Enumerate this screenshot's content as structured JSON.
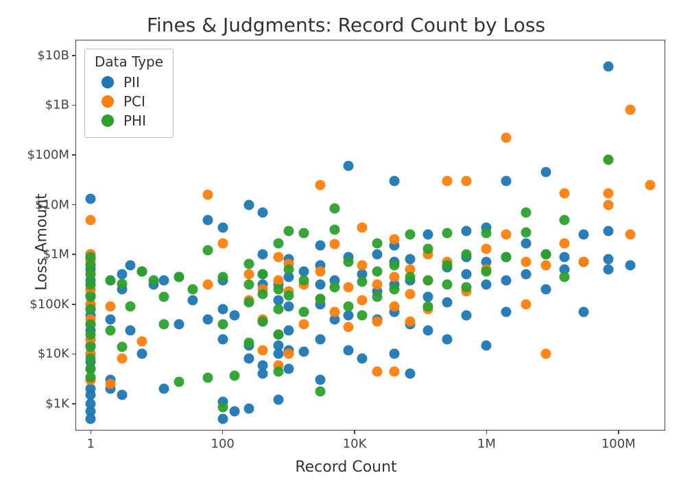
{
  "chart_data": {
    "type": "scatter",
    "title": "Fines & Judgments: Record Count by Loss",
    "xlabel": "Record Count",
    "ylabel": "Loss Amount",
    "xscale": "log",
    "yscale": "log",
    "xlim": [
      0.6,
      500000000
    ],
    "ylim": [
      300,
      20000000000
    ],
    "xticks": [
      1,
      100,
      10000,
      1000000,
      100000000
    ],
    "xticklabels": [
      "1",
      "100",
      "10K",
      "1M",
      "100M"
    ],
    "yticks": [
      1000,
      10000,
      100000,
      1000000,
      10000000,
      100000000,
      1000000000,
      10000000000
    ],
    "yticklabels": [
      "$1K",
      "$10K",
      "$100K",
      "$1M",
      "$10M",
      "$100M",
      "$1B",
      "$10B"
    ],
    "legend": {
      "title": "Data Type",
      "entries": [
        "PII",
        "PCI",
        "PHI"
      ],
      "position": "upper-left"
    },
    "colors": {
      "PII": "#1f77b4",
      "PCI": "#ff7f0e",
      "PHI": "#2ca02c"
    },
    "series": [
      {
        "name": "PII",
        "points": [
          [
            1,
            13000000
          ],
          [
            1,
            1000000
          ],
          [
            1,
            800000
          ],
          [
            1,
            600000
          ],
          [
            1,
            500000
          ],
          [
            1,
            400000
          ],
          [
            1,
            300000
          ],
          [
            1,
            250000
          ],
          [
            1,
            200000
          ],
          [
            1,
            150000
          ],
          [
            1,
            100000
          ],
          [
            1,
            80000
          ],
          [
            1,
            60000
          ],
          [
            1,
            40000
          ],
          [
            1,
            30000
          ],
          [
            1,
            20000
          ],
          [
            1,
            15000
          ],
          [
            1,
            10000
          ],
          [
            1,
            7000
          ],
          [
            1,
            5000
          ],
          [
            1,
            3000
          ],
          [
            1,
            2000
          ],
          [
            1,
            1500
          ],
          [
            1,
            1000
          ],
          [
            1,
            700
          ],
          [
            1,
            500
          ],
          [
            2,
            300000
          ],
          [
            2,
            50000
          ],
          [
            2,
            3000
          ],
          [
            2,
            2000
          ],
          [
            3,
            400000
          ],
          [
            3,
            200000
          ],
          [
            3,
            1500
          ],
          [
            4,
            600000
          ],
          [
            4,
            30000
          ],
          [
            6,
            450000
          ],
          [
            6,
            10000
          ],
          [
            9,
            250000
          ],
          [
            13,
            300000
          ],
          [
            13,
            2000
          ],
          [
            22,
            350000
          ],
          [
            22,
            40000
          ],
          [
            35,
            120000
          ],
          [
            60,
            5000000
          ],
          [
            60,
            50000
          ],
          [
            100,
            3500000
          ],
          [
            100,
            300000
          ],
          [
            100,
            80000
          ],
          [
            100,
            20000
          ],
          [
            100,
            1100
          ],
          [
            100,
            500
          ],
          [
            150,
            700
          ],
          [
            150,
            60000
          ],
          [
            250,
            10000000
          ],
          [
            250,
            800
          ],
          [
            250,
            8000
          ],
          [
            250,
            15000
          ],
          [
            400,
            7000000
          ],
          [
            400,
            1000000
          ],
          [
            400,
            400000
          ],
          [
            400,
            250000
          ],
          [
            400,
            45000
          ],
          [
            400,
            6000
          ],
          [
            400,
            4000
          ],
          [
            700,
            250000
          ],
          [
            700,
            120000
          ],
          [
            700,
            25000
          ],
          [
            700,
            15000
          ],
          [
            700,
            10000
          ],
          [
            700,
            1200
          ],
          [
            1000,
            800000
          ],
          [
            1000,
            350000
          ],
          [
            1000,
            90000
          ],
          [
            1000,
            30000
          ],
          [
            1000,
            12000
          ],
          [
            1000,
            5000
          ],
          [
            1700,
            450000
          ],
          [
            1700,
            11000
          ],
          [
            3000,
            1500000
          ],
          [
            3000,
            600000
          ],
          [
            3000,
            250000
          ],
          [
            3000,
            100000
          ],
          [
            3000,
            20000
          ],
          [
            3000,
            3000
          ],
          [
            5000,
            300000
          ],
          [
            5000,
            50000
          ],
          [
            8000,
            60000000
          ],
          [
            8000,
            900000
          ],
          [
            8000,
            60000
          ],
          [
            8000,
            12000
          ],
          [
            13000,
            400000
          ],
          [
            13000,
            8000
          ],
          [
            22000,
            1000000
          ],
          [
            22000,
            180000
          ],
          [
            22000,
            50000
          ],
          [
            40000,
            30000000
          ],
          [
            40000,
            1500000
          ],
          [
            40000,
            700000
          ],
          [
            40000,
            250000
          ],
          [
            40000,
            70000
          ],
          [
            40000,
            10000
          ],
          [
            70000,
            800000
          ],
          [
            70000,
            300000
          ],
          [
            70000,
            40000
          ],
          [
            70000,
            4000
          ],
          [
            130000,
            2500000
          ],
          [
            130000,
            140000
          ],
          [
            130000,
            30000
          ],
          [
            250000,
            550000
          ],
          [
            250000,
            110000
          ],
          [
            250000,
            20000
          ],
          [
            500000,
            3000000
          ],
          [
            500000,
            900000
          ],
          [
            500000,
            400000
          ],
          [
            500000,
            60000
          ],
          [
            1000000,
            3500000
          ],
          [
            1000000,
            700000
          ],
          [
            1000000,
            250000
          ],
          [
            1000000,
            15000
          ],
          [
            2000000,
            30000000
          ],
          [
            2000000,
            900000
          ],
          [
            2000000,
            300000
          ],
          [
            2000000,
            70000
          ],
          [
            4000000,
            1700000
          ],
          [
            4000000,
            400000
          ],
          [
            8000000,
            45000000
          ],
          [
            8000000,
            1000000
          ],
          [
            8000000,
            200000
          ],
          [
            15000000,
            900000
          ],
          [
            15000000,
            500000
          ],
          [
            30000000,
            2500000
          ],
          [
            30000000,
            700000
          ],
          [
            30000000,
            70000
          ],
          [
            70000000,
            6000000000
          ],
          [
            70000000,
            3000000
          ],
          [
            70000000,
            800000
          ],
          [
            70000000,
            500000
          ],
          [
            150000000,
            600000
          ]
        ]
      },
      {
        "name": "PCI",
        "points": [
          [
            1,
            5000000
          ],
          [
            1,
            1000000
          ],
          [
            1,
            700000
          ],
          [
            1,
            400000
          ],
          [
            1,
            200000
          ],
          [
            1,
            100000
          ],
          [
            1,
            50000
          ],
          [
            1,
            20000
          ],
          [
            1,
            10000
          ],
          [
            1,
            3000
          ],
          [
            2,
            90000
          ],
          [
            2,
            2500
          ],
          [
            3,
            8000
          ],
          [
            6,
            18000
          ],
          [
            60,
            16000000
          ],
          [
            60,
            250000
          ],
          [
            100,
            1700000
          ],
          [
            250,
            400000
          ],
          [
            250,
            120000
          ],
          [
            400,
            200000
          ],
          [
            400,
            50000
          ],
          [
            400,
            12000
          ],
          [
            700,
            900000
          ],
          [
            700,
            300000
          ],
          [
            700,
            6000
          ],
          [
            1000,
            650000
          ],
          [
            1000,
            180000
          ],
          [
            1000,
            10000
          ],
          [
            1700,
            250000
          ],
          [
            1700,
            40000
          ],
          [
            3000,
            25000000
          ],
          [
            3000,
            450000
          ],
          [
            3000,
            130000
          ],
          [
            5000,
            1600000
          ],
          [
            5000,
            70000
          ],
          [
            8000,
            220000
          ],
          [
            8000,
            35000
          ],
          [
            13000,
            3500000
          ],
          [
            13000,
            600000
          ],
          [
            13000,
            120000
          ],
          [
            22000,
            250000
          ],
          [
            22000,
            45000
          ],
          [
            22000,
            4500
          ],
          [
            40000,
            2000000
          ],
          [
            40000,
            350000
          ],
          [
            40000,
            90000
          ],
          [
            40000,
            4500
          ],
          [
            70000,
            500000
          ],
          [
            70000,
            160000
          ],
          [
            70000,
            45000
          ],
          [
            130000,
            1000000
          ],
          [
            130000,
            300000
          ],
          [
            130000,
            80000
          ],
          [
            250000,
            30000000
          ],
          [
            250000,
            700000
          ],
          [
            500000,
            30000000
          ],
          [
            500000,
            180000
          ],
          [
            1000000,
            1300000
          ],
          [
            1000000,
            500000
          ],
          [
            2000000,
            220000000
          ],
          [
            2000000,
            2500000
          ],
          [
            4000000,
            700000
          ],
          [
            4000000,
            100000
          ],
          [
            8000000,
            600000
          ],
          [
            8000000,
            10000
          ],
          [
            15000000,
            17000000
          ],
          [
            15000000,
            1700000
          ],
          [
            30000000,
            700000
          ],
          [
            70000000,
            80000000
          ],
          [
            70000000,
            17000000
          ],
          [
            70000000,
            10000000
          ],
          [
            150000000,
            800000000
          ],
          [
            150000000,
            2500000
          ],
          [
            300000000,
            25000000
          ]
        ]
      },
      {
        "name": "PHI",
        "points": [
          [
            1,
            900000
          ],
          [
            1,
            600000
          ],
          [
            1,
            400000
          ],
          [
            1,
            250000
          ],
          [
            1,
            140000
          ],
          [
            1,
            80000
          ],
          [
            1,
            40000
          ],
          [
            1,
            25000
          ],
          [
            1,
            14000
          ],
          [
            1,
            8000
          ],
          [
            1,
            5000
          ],
          [
            1,
            3500
          ],
          [
            2,
            300000
          ],
          [
            2,
            30000
          ],
          [
            3,
            260000
          ],
          [
            3,
            14000
          ],
          [
            4,
            90000
          ],
          [
            6,
            450000
          ],
          [
            9,
            300000
          ],
          [
            13,
            140000
          ],
          [
            13,
            40000
          ],
          [
            22,
            350000
          ],
          [
            22,
            2800
          ],
          [
            35,
            200000
          ],
          [
            60,
            1200000
          ],
          [
            60,
            3300
          ],
          [
            100,
            350000
          ],
          [
            100,
            40000
          ],
          [
            100,
            850
          ],
          [
            150,
            3700
          ],
          [
            250,
            650000
          ],
          [
            250,
            250000
          ],
          [
            250,
            110000
          ],
          [
            250,
            17000
          ],
          [
            400,
            400000
          ],
          [
            400,
            160000
          ],
          [
            400,
            45000
          ],
          [
            700,
            1700000
          ],
          [
            700,
            200000
          ],
          [
            700,
            80000
          ],
          [
            700,
            25000
          ],
          [
            700,
            4500
          ],
          [
            1000,
            3000000
          ],
          [
            1000,
            500000
          ],
          [
            1000,
            150000
          ],
          [
            1700,
            2700000
          ],
          [
            1700,
            300000
          ],
          [
            1700,
            70000
          ],
          [
            3000,
            130000
          ],
          [
            3000,
            1800
          ],
          [
            5000,
            3200000
          ],
          [
            5000,
            8500000
          ],
          [
            5000,
            220000
          ],
          [
            8000,
            700000
          ],
          [
            8000,
            90000
          ],
          [
            13000,
            280000
          ],
          [
            13000,
            60000
          ],
          [
            22000,
            1700000
          ],
          [
            22000,
            450000
          ],
          [
            22000,
            140000
          ],
          [
            40000,
            600000
          ],
          [
            40000,
            200000
          ],
          [
            70000,
            2500000
          ],
          [
            70000,
            350000
          ],
          [
            130000,
            1300000
          ],
          [
            130000,
            300000
          ],
          [
            130000,
            90000
          ],
          [
            250000,
            2700000
          ],
          [
            250000,
            600000
          ],
          [
            250000,
            250000
          ],
          [
            500000,
            1000000
          ],
          [
            500000,
            220000
          ],
          [
            1000000,
            2700000
          ],
          [
            1000000,
            450000
          ],
          [
            2000000,
            900000
          ],
          [
            4000000,
            7000000
          ],
          [
            4000000,
            2800000
          ],
          [
            8000000,
            1000000
          ],
          [
            15000000,
            5000000
          ],
          [
            15000000,
            350000
          ],
          [
            70000000,
            80000000
          ]
        ]
      }
    ]
  }
}
